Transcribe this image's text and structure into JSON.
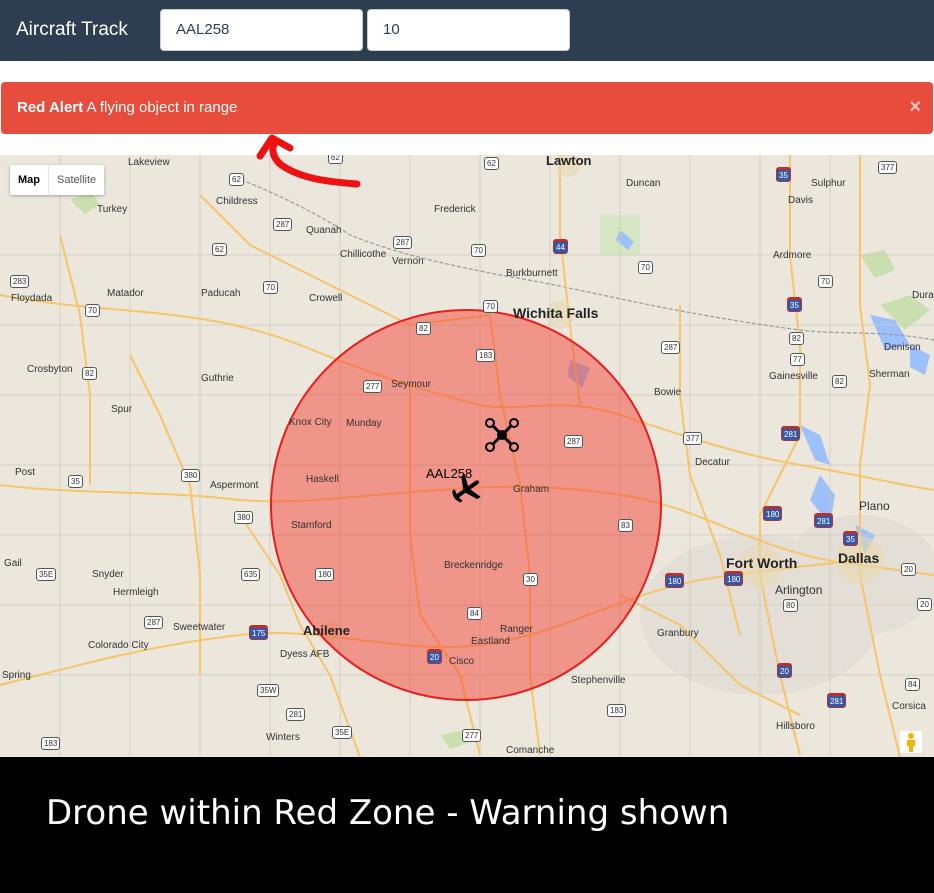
{
  "navbar": {
    "brand": "Aircraft Track",
    "callsign_value": "AAL258",
    "range_value": "10"
  },
  "alert": {
    "title": "Red Alert",
    "message": "A flying object in range",
    "close_glyph": "×",
    "color": "#e74c3c"
  },
  "map": {
    "type_controls": [
      "Map",
      "Satellite"
    ],
    "active_type": "Map",
    "aircraft_label": "AAL258",
    "zone_color": "#f4433680",
    "cities_large": [
      "Wichita Falls",
      "Abilene",
      "Fort Worth",
      "Dallas",
      "Lawton"
    ],
    "cities": [
      "Lakeview",
      "Childress",
      "Turkey",
      "Quanah",
      "Frederick",
      "Duncan",
      "Sulphur",
      "Davis",
      "Chillicothe",
      "Vernon",
      "Burkburnett",
      "Ardmore",
      "Floydada",
      "Matador",
      "Paducah",
      "Crowell",
      "Seymour",
      "Munday",
      "Knox City",
      "Crosbyton",
      "Guthrie",
      "Spur",
      "Haskell",
      "Aspermont",
      "Post",
      "Stamford",
      "Graham",
      "Gail",
      "Snyder",
      "Hermleigh",
      "Breckenridge",
      "Sweetwater",
      "Colorado City",
      "Dyess AFB",
      "Eastland",
      "Cisco",
      "Ranger",
      "Spring",
      "Winters",
      "Stephenville",
      "Granbury",
      "Comanche",
      "Hillsboro",
      "Corsica",
      "Arlington",
      "Plano",
      "Decatur",
      "Bowie",
      "Gainesville",
      "Sherman",
      "Denison",
      "Durant"
    ],
    "routes": [
      "62",
      "62",
      "62",
      "287",
      "70",
      "62",
      "35",
      "377",
      "287",
      "70",
      "44",
      "70",
      "35",
      "70",
      "283",
      "70",
      "70",
      "287",
      "82",
      "183",
      "277",
      "82",
      "82",
      "77",
      "82",
      "377",
      "287",
      "281",
      "35",
      "380",
      "380",
      "83",
      "180",
      "281",
      "35",
      "35E",
      "635",
      "180",
      "180",
      "180",
      "20",
      "30",
      "80",
      "20",
      "287",
      "175",
      "84",
      "20",
      "183",
      "20",
      "281",
      "35W",
      "35E",
      "277",
      "84",
      "183",
      "281",
      "87",
      "83"
    ]
  },
  "caption": {
    "text": "Drone within Red Zone - Warning shown"
  }
}
